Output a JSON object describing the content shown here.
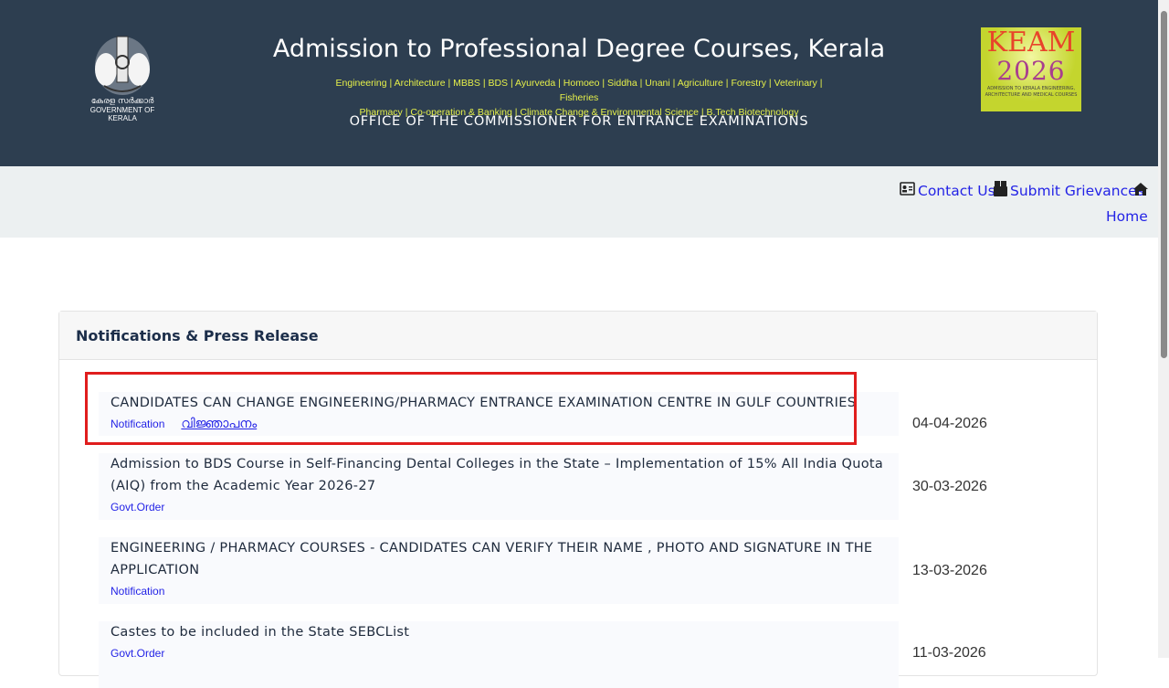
{
  "header": {
    "title": "Admission to Professional Degree Courses, Kerala",
    "courses_line1": "Engineering | Architecture | MBBS | BDS | Ayurveda | Homoeo | Siddha | Unani | Agriculture | Forestry | Veterinary | Fisheries",
    "courses_line2": "Pharmacy | Co-operation & Banking | Climate Change & Environmental Science | B.Tech Biotechnology",
    "office": "OFFICE OF THE COMMISSIONER FOR ENTRANCE EXAMINATIONS",
    "emblem_ml": "കേരള സർക്കാർ",
    "emblem_en": "GOVERNMENT OF KERALA",
    "keam_word": "KEAM",
    "keam_year": "2026",
    "keam_sub": "ADMISSION TO KERALA ENGINEERING, ARCHITECTURE AND MEDICAL COURSES"
  },
  "nav": {
    "contact": "Contact Us",
    "grievances": "Submit Grievances",
    "home": "Home"
  },
  "notifications": {
    "heading": "Notifications & Press Release",
    "items": [
      {
        "title": "CANDIDATES CAN CHANGE ENGINEERING/PHARMACY ENTRANCE EXAMINATION CENTRE IN GULF COUNTRIES",
        "link": "Notification",
        "link_ml": "വിജ്ഞാപനം",
        "date": "04-04-2026"
      },
      {
        "title": "Admission to BDS Course in Self-Financing Dental Colleges in the State – Implementation of 15% All India Quota (AIQ) from the Academic Year 2026-27",
        "link": "Govt.Order",
        "date": "30-03-2026"
      },
      {
        "title": "ENGINEERING / PHARMACY COURSES - CANDIDATES CAN VERIFY THEIR NAME , PHOTO AND SIGNATURE IN THE APPLICATION",
        "link": "Notification",
        "date": "13-03-2026"
      },
      {
        "title": "Castes to be included in the State SEBCList",
        "link": "Govt.Order",
        "date": "11-03-2026"
      }
    ]
  }
}
